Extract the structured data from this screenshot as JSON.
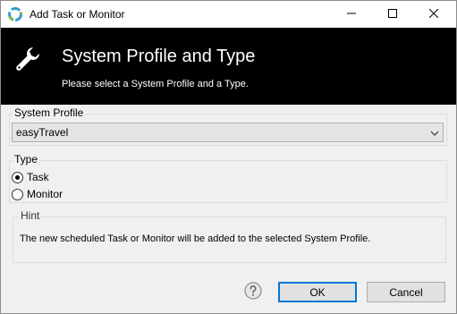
{
  "window": {
    "title": "Add Task or Monitor",
    "icons": {
      "app": "app-logo-icon",
      "minimize": "minimize-icon",
      "maximize": "maximize-icon",
      "close": "close-icon"
    }
  },
  "banner": {
    "icon": "wrench-icon",
    "title": "System Profile and Type",
    "subtitle": "Please select a System Profile and a Type."
  },
  "system_profile": {
    "label": "System Profile",
    "selected": "easyTravel"
  },
  "type": {
    "label": "Type",
    "options": [
      {
        "label": "Task",
        "checked": true
      },
      {
        "label": "Monitor",
        "checked": false
      }
    ]
  },
  "hint": {
    "label": "Hint",
    "text": "The new scheduled Task or Monitor will be added to the selected System Profile."
  },
  "buttons": {
    "help_icon": "help-icon",
    "ok": "OK",
    "cancel": "Cancel"
  },
  "colors": {
    "banner_bg": "#000000",
    "dialog_bg": "#f0f0f0",
    "default_button_border": "#0078d7"
  }
}
